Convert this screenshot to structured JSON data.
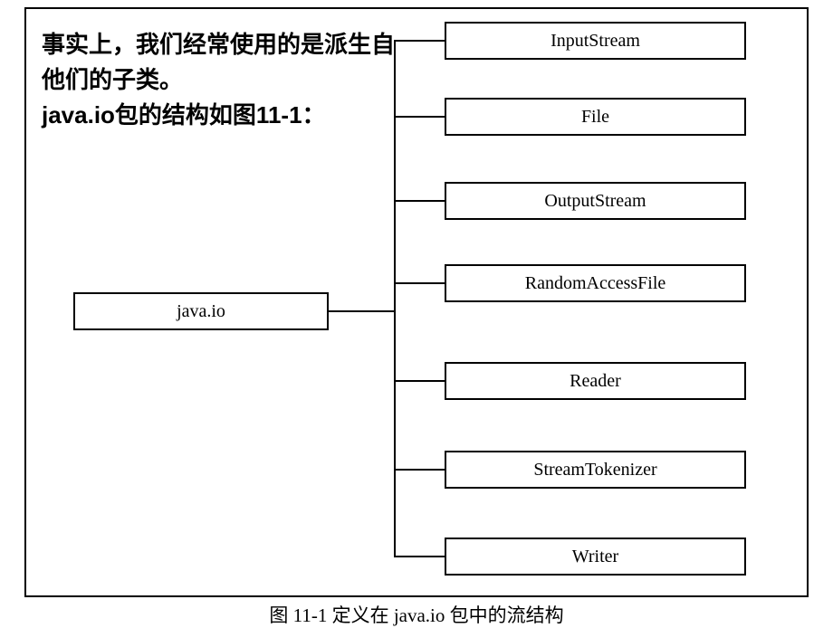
{
  "description": {
    "line1": "事实上，我们经常使用的是派生自他们的子类。",
    "line2": "java.io包的结构如图11-1："
  },
  "diagram": {
    "root": "java.io",
    "children": [
      "InputStream",
      "File",
      "OutputStream",
      "RandomAccessFile",
      "Reader",
      "StreamTokenizer",
      "Writer"
    ]
  },
  "caption": "图 11-1 定义在 java.io 包中的流结构"
}
